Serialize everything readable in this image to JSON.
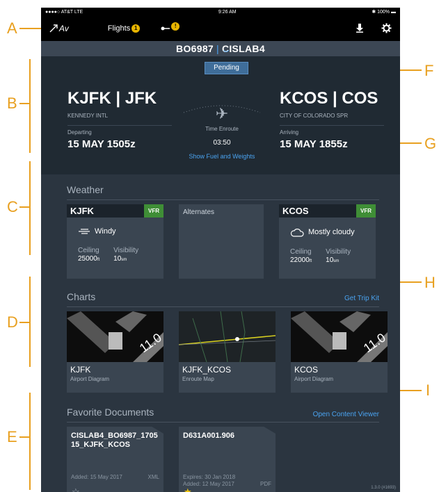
{
  "callouts": [
    "A",
    "B",
    "C",
    "D",
    "E",
    "F",
    "G",
    "H",
    "I"
  ],
  "statusbar": {
    "carrier": "●●●●○ AT&T  LTE",
    "time": "9:26 AM",
    "battery": "✱ 100% ▬"
  },
  "navbar": {
    "logo": "Av",
    "flights_label": "Flights",
    "flights_badge": "1",
    "alert_badge": "!"
  },
  "flight": {
    "number": "BO6987",
    "aircraft": "CISLAB4",
    "status": "Pending"
  },
  "departure": {
    "code": "KJFK | JFK",
    "name": "KENNEDY INTL",
    "label": "Departing",
    "time": "15 MAY 1505z"
  },
  "arrival": {
    "code": "KCOS | COS",
    "name": "CITY OF COLORADO SPR",
    "label": "Arriving",
    "time": "15 MAY 1855z"
  },
  "enroute": {
    "label": "Time Enroute",
    "duration": "03:50",
    "fuel_link": "Show Fuel and Weights"
  },
  "weather": {
    "title": "Weather",
    "origin": {
      "station": "KJFK",
      "rule": "VFR",
      "condition": "Windy",
      "ceiling_label": "Ceiling",
      "ceiling": "25000",
      "ceiling_unit": "ft",
      "visibility_label": "Visibility",
      "visibility": "10",
      "visibility_unit": "sm"
    },
    "alternates_label": "Alternates",
    "destination": {
      "station": "KCOS",
      "rule": "VFR",
      "condition": "Mostly cloudy",
      "ceiling_label": "Ceiling",
      "ceiling": "22000",
      "ceiling_unit": "ft",
      "visibility_label": "Visibility",
      "visibility": "10",
      "visibility_unit": "sm"
    }
  },
  "charts": {
    "title": "Charts",
    "link": "Get Trip Kit",
    "items": [
      {
        "name": "KJFK",
        "type": "Airport Diagram"
      },
      {
        "name": "KJFK_KCOS",
        "type": "Enroute Map"
      },
      {
        "name": "KCOS",
        "type": "Airport Diagram"
      }
    ]
  },
  "documents": {
    "title": "Favorite Documents",
    "link": "Open Content Viewer",
    "items": [
      {
        "title": "CISLAB4_BO6987_170515_KJFK_KCOS",
        "expires": "",
        "added": "Added: 15 May 2017",
        "ext": "XML",
        "star": "☆"
      },
      {
        "title": "D631A001.906",
        "expires": "Expires: 30 Jan 2018",
        "added": "Added: 12 May 2017",
        "ext": "PDF",
        "star": "★"
      }
    ]
  },
  "version": "1.3.0 (#1693)"
}
